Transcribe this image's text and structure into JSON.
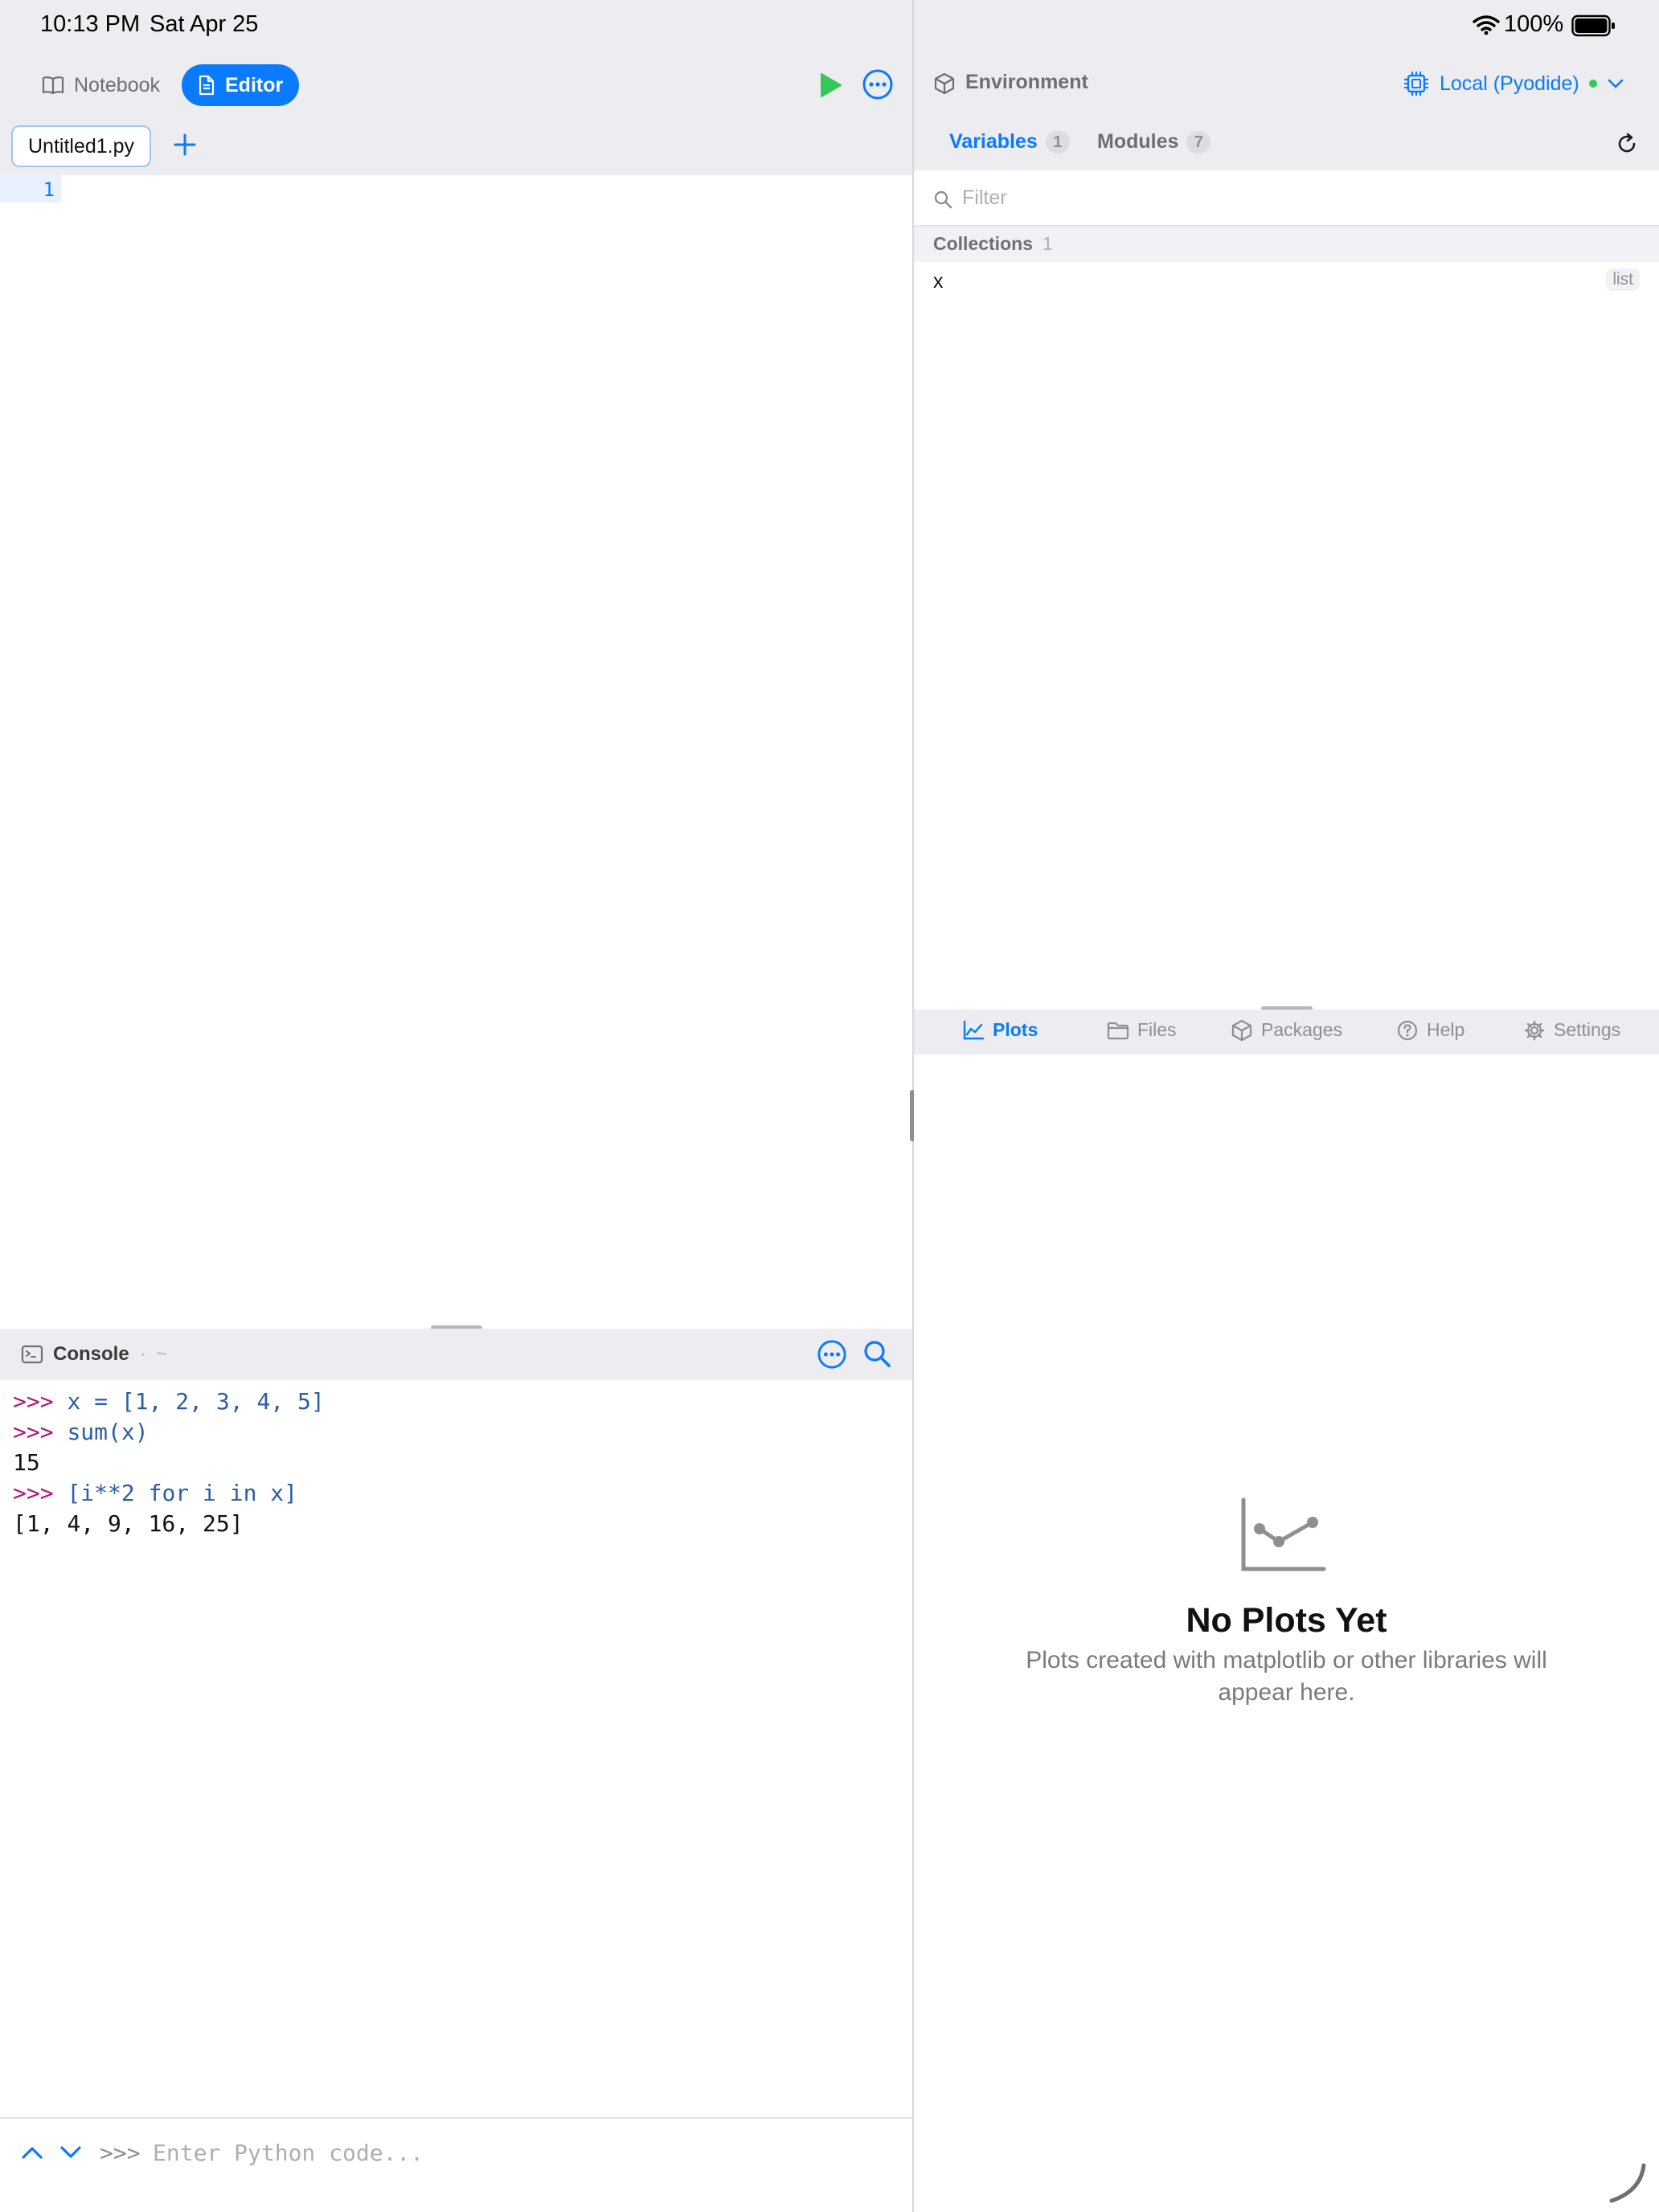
{
  "status_bar": {
    "time": "10:13 PM",
    "date": "Sat Apr 25",
    "battery": "100%",
    "icons": [
      "wifi-icon",
      "battery-icon"
    ]
  },
  "editor": {
    "mode_tabs": [
      {
        "label": "Notebook",
        "icon": "book-icon",
        "selected": false
      },
      {
        "label": "Editor",
        "icon": "document-icon",
        "selected": true
      }
    ],
    "toolbar_icons": [
      "play-icon",
      "ellipsis-circle-icon"
    ],
    "file_tabs": [
      {
        "label": "Untitled1.py",
        "active": true
      }
    ],
    "add_tab_icon": "plus-icon",
    "line_numbers": [
      "1"
    ]
  },
  "console": {
    "title": "Console",
    "separator": "·",
    "directory": "~",
    "header_icons": [
      "terminal-icon",
      "ellipsis-circle-icon",
      "search-icon"
    ],
    "lines": [
      {
        "prompt": ">>>",
        "text": "x = [1, 2, 3, 4, 5]"
      },
      {
        "prompt": ">>>",
        "text": "sum(x)"
      },
      {
        "output": "15"
      },
      {
        "prompt": ">>>",
        "text": "[i**2 for i in x]"
      },
      {
        "output": "[1, 4, 9, 16, 25]"
      }
    ],
    "input_prompt": ">>>",
    "input_placeholder": "Enter Python code...",
    "input_value": "",
    "history_icons": [
      "chevron-up-icon",
      "chevron-down-icon"
    ]
  },
  "environment": {
    "title": "Environment",
    "kernel": "Local (Pyodide)",
    "kernel_status_color": "#34c759",
    "tabs": [
      {
        "label": "Variables",
        "count": "1",
        "active": true
      },
      {
        "label": "Modules",
        "count": "7",
        "active": false
      }
    ],
    "filter_placeholder": "Filter",
    "filter_value": "",
    "groups": [
      {
        "title": "Collections",
        "count": "1",
        "items": [
          {
            "name": "x",
            "type": "list"
          }
        ]
      }
    ]
  },
  "bottom_tabs": [
    {
      "label": "Plots",
      "icon": "line-chart-icon",
      "active": true
    },
    {
      "label": "Files",
      "icon": "folder-icon",
      "active": false
    },
    {
      "label": "Packages",
      "icon": "cube-icon",
      "active": false
    },
    {
      "label": "Help",
      "icon": "question-circle-icon",
      "active": false
    },
    {
      "label": "Settings",
      "icon": "gear-icon",
      "active": false
    }
  ],
  "plots": {
    "empty_title": "No Plots Yet",
    "empty_message": "Plots created with matplotlib or other libraries will appear here."
  },
  "colors": {
    "accent": "#0a7aff",
    "run": "#34c759",
    "prompt": "#b4157a",
    "code": "#2b5ea6",
    "header_bg": "#ececf1"
  }
}
